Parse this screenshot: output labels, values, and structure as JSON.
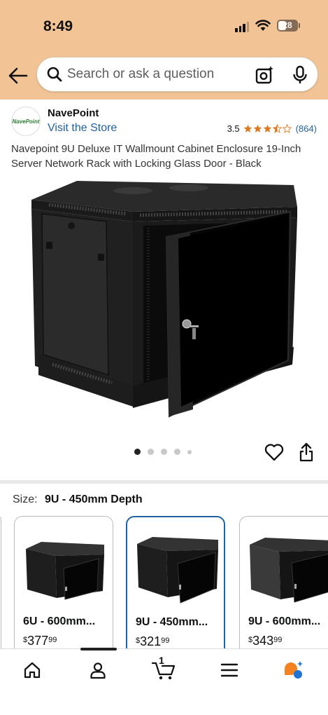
{
  "status_bar": {
    "time": "8:49",
    "battery": "28"
  },
  "search": {
    "placeholder": "Search or ask a question"
  },
  "brand": {
    "name": "NavePoint",
    "logo_text": "NavePoint",
    "visit_store": "Visit the Store",
    "rating": "3.5",
    "rating_count": "(864)",
    "star_color": "#de7921"
  },
  "product": {
    "title": "Navepoint 9U Deluxe IT Wallmount Cabinet Enclosure 19-Inch Server Network Rack with Locking Glass Door - Black",
    "image_count": 5,
    "active_image": 1
  },
  "size": {
    "label": "Size:",
    "value": "9U - 450mm Depth"
  },
  "variants": [
    {
      "title": "6U - 600mm...",
      "currency": "$",
      "whole": "377",
      "fraction": "99",
      "selected": false
    },
    {
      "title": "9U - 450mm...",
      "currency": "$",
      "whole": "321",
      "fraction": "99",
      "selected": true
    },
    {
      "title": "9U - 600mm...",
      "currency": "$",
      "whole": "343",
      "fraction": "99",
      "selected": false
    }
  ],
  "bottom_nav": {
    "items": [
      "home-icon",
      "account-icon",
      "cart-icon",
      "menu-icon",
      "rufus-icon"
    ],
    "cart_count": "1",
    "active_index": 1
  },
  "colors": {
    "header_bg": "#f2c394",
    "link": "#2162a1",
    "selected_border": "#2162a1"
  }
}
